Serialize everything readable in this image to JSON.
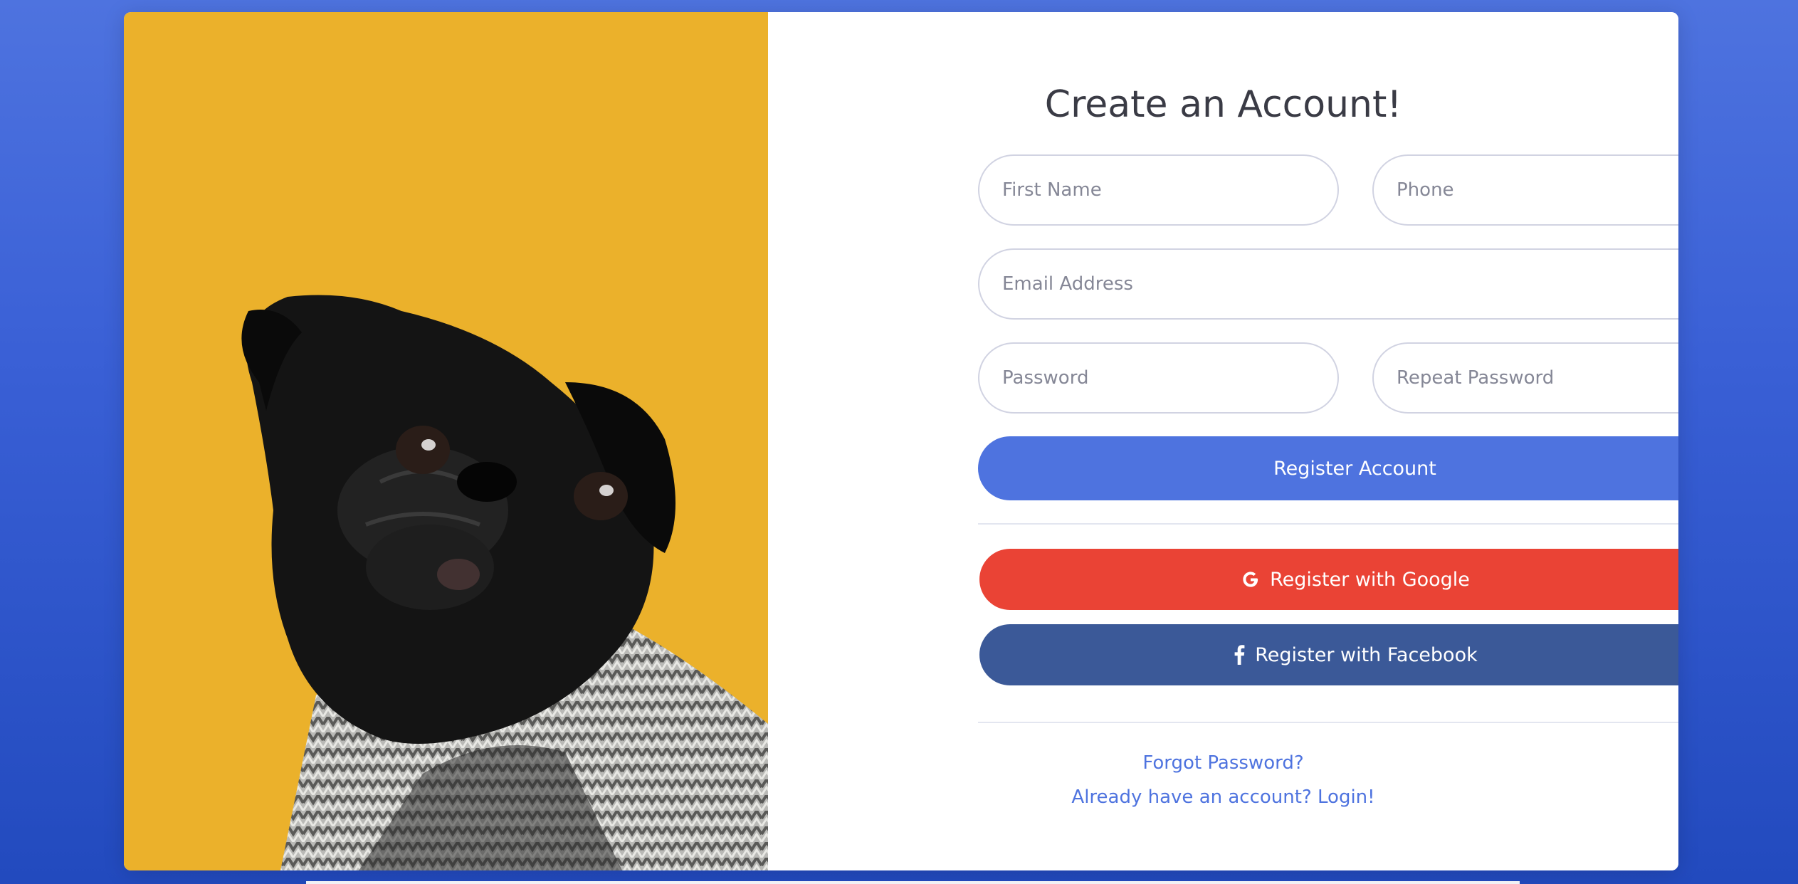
{
  "form": {
    "title": "Create an Account!",
    "first_name_placeholder": "First Name",
    "phone_placeholder": "Phone",
    "email_placeholder": "Email Address",
    "password_placeholder": "Password",
    "repeat_password_placeholder": "Repeat Password",
    "register_label": "Register Account",
    "google_label": "Register with Google",
    "facebook_label": "Register with Facebook",
    "forgot_password_link": "Forgot Password?",
    "login_link": "Already have an account? Login!"
  },
  "image": {
    "subject": "pug in knitted sweater",
    "background_color": "#ebb12b"
  },
  "colors": {
    "primary": "#4e73df",
    "google": "#ea4335",
    "facebook": "#3b5998"
  },
  "icons": {
    "google": "google-icon",
    "facebook": "facebook-icon"
  }
}
